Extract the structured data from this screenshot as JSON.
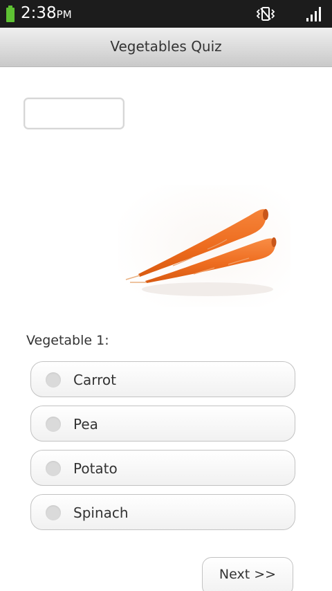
{
  "status_bar": {
    "time": "2:38",
    "ampm": "PM",
    "icons": [
      "battery-icon",
      "vibrate-icon",
      "signal-icon"
    ],
    "battery_color": "#5ec233"
  },
  "title_bar": {
    "title": "Vegetables Quiz"
  },
  "answer_input": {
    "value": "",
    "placeholder": ""
  },
  "image": {
    "subject": "carrot"
  },
  "question": {
    "label": "Vegetable 1:"
  },
  "options": [
    {
      "label": "Carrot",
      "selected": false
    },
    {
      "label": "Pea",
      "selected": false
    },
    {
      "label": "Potato",
      "selected": false
    },
    {
      "label": "Spinach",
      "selected": false
    }
  ],
  "next_button": {
    "label": "Next >>"
  },
  "colors": {
    "status_bar_bg": "#1c1c1c",
    "title_text": "#333333",
    "carrot_orange": "#f0701e"
  }
}
